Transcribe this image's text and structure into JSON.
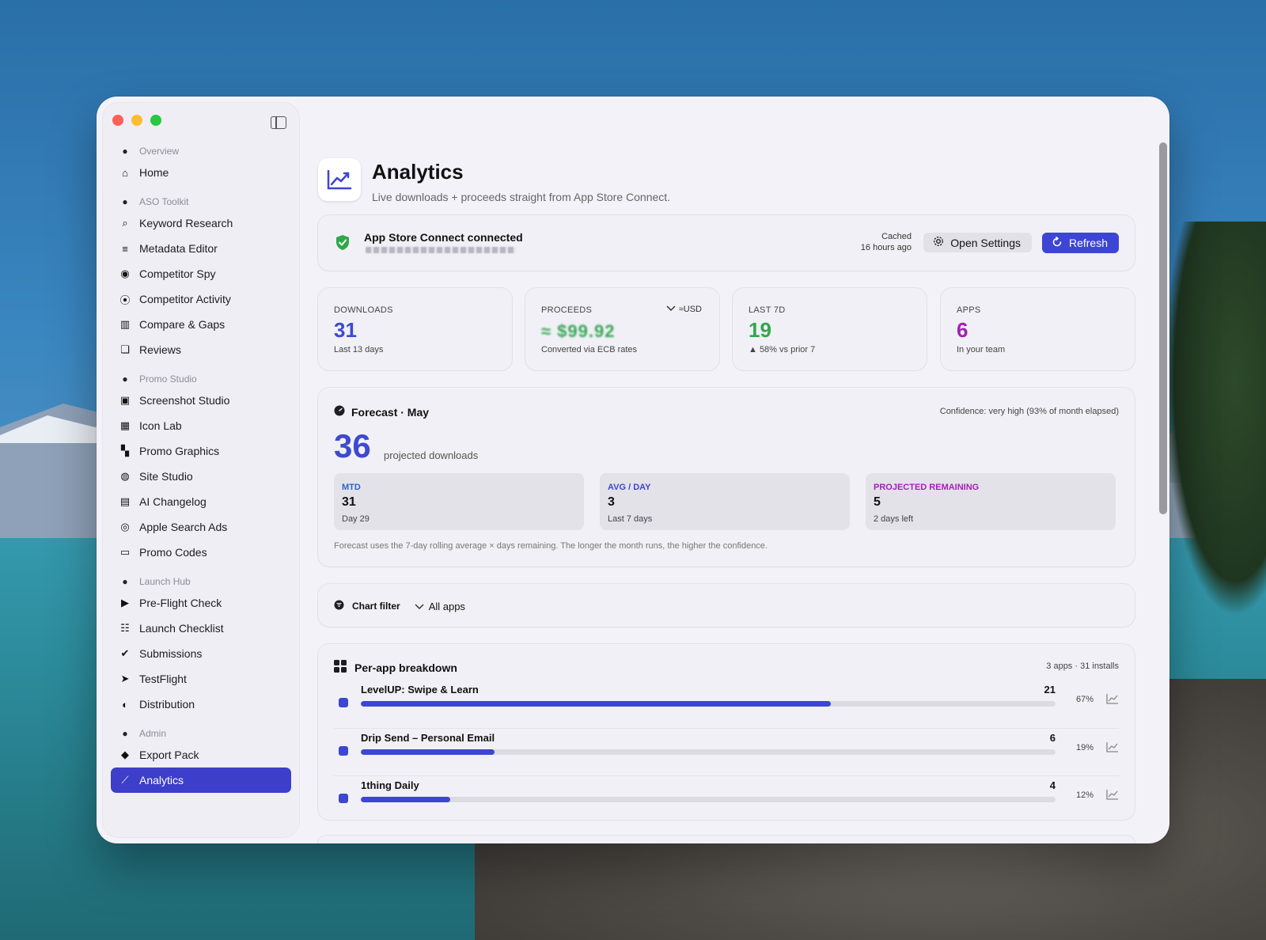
{
  "sidebar": {
    "sections": [
      {
        "label": "Overview",
        "icon": "house-icon",
        "items": [
          {
            "label": "Home",
            "icon": "house-icon",
            "glyph": "⌂"
          }
        ]
      },
      {
        "label": "ASO Toolkit",
        "icon": "magnifier-circle-icon",
        "items": [
          {
            "label": "Keyword Research",
            "icon": "search-icon",
            "glyph": "⌕"
          },
          {
            "label": "Metadata Editor",
            "icon": "text-align-icon",
            "glyph": "≡"
          },
          {
            "label": "Competitor Spy",
            "icon": "eye-icon",
            "glyph": "◉"
          },
          {
            "label": "Competitor Activity",
            "icon": "broadcast-icon",
            "glyph": "⦿"
          },
          {
            "label": "Compare & Gaps",
            "icon": "columns-icon",
            "glyph": "▥"
          },
          {
            "label": "Reviews",
            "icon": "chat-bubbles-icon",
            "glyph": "❏"
          }
        ]
      },
      {
        "label": "Promo Studio",
        "icon": "bag-icon",
        "items": [
          {
            "label": "Screenshot Studio",
            "icon": "photos-icon",
            "glyph": "▣"
          },
          {
            "label": "Icon Lab",
            "icon": "app-grid-icon",
            "glyph": "▦"
          },
          {
            "label": "Promo Graphics",
            "icon": "layout-icon",
            "glyph": "▚"
          },
          {
            "label": "Site Studio",
            "icon": "globe-icon",
            "glyph": "◍"
          },
          {
            "label": "AI Changelog",
            "icon": "document-icon",
            "glyph": "▤"
          },
          {
            "label": "Apple Search Ads",
            "icon": "search-badge-icon",
            "glyph": "◎"
          },
          {
            "label": "Promo Codes",
            "icon": "ticket-icon",
            "glyph": "▭"
          }
        ]
      },
      {
        "label": "Launch Hub",
        "icon": "checkmark-circle-icon",
        "items": [
          {
            "label": "Pre-Flight Check",
            "icon": "play-circle-icon",
            "glyph": "▶"
          },
          {
            "label": "Launch Checklist",
            "icon": "checklist-icon",
            "glyph": "☷"
          },
          {
            "label": "Submissions",
            "icon": "seal-check-icon",
            "glyph": "✔"
          },
          {
            "label": "TestFlight",
            "icon": "paperplane-icon",
            "glyph": "➤"
          },
          {
            "label": "Distribution",
            "icon": "globe-grid-icon",
            "glyph": "◐"
          }
        ]
      },
      {
        "label": "Admin",
        "icon": "tools-icon",
        "items": [
          {
            "label": "Export Pack",
            "icon": "box-icon",
            "glyph": "◆"
          },
          {
            "label": "Analytics",
            "icon": "chart-line-icon",
            "glyph": "⟋",
            "active": true
          }
        ]
      }
    ]
  },
  "header": {
    "title": "Analytics",
    "subtitle": "Live downloads + proceeds straight from App Store Connect."
  },
  "connection": {
    "title": "App Store Connect connected",
    "cached_label": "Cached",
    "cached_time": "16 hours ago",
    "settings_label": "Open Settings",
    "refresh_label": "Refresh"
  },
  "stats": {
    "downloads": {
      "label": "DOWNLOADS",
      "value": "31",
      "sub": "Last 13 days",
      "color": "#3d4ad0"
    },
    "proceeds": {
      "label": "PROCEEDS",
      "currency": "≈USD",
      "value": "≈ $99.92",
      "sub": "Converted via ECB rates",
      "color": "#34a853"
    },
    "last7d": {
      "label": "LAST 7D",
      "value": "19",
      "sub": "▲ 58% vs prior 7",
      "color": "#2fa84a"
    },
    "apps": {
      "label": "APPS",
      "value": "6",
      "sub": "In your team",
      "color": "#a21fb8"
    }
  },
  "forecast": {
    "title": "Forecast · May",
    "confidence": "Confidence: very high (93% of month elapsed)",
    "projected": "36",
    "projected_label": "projected downloads",
    "cards": [
      {
        "label": "MTD",
        "value": "31",
        "sub": "Day 29",
        "color": "#2f62c7"
      },
      {
        "label": "AVG / DAY",
        "value": "3",
        "sub": "Last 7 days",
        "color": "#3d46c9"
      },
      {
        "label": "PROJECTED REMAINING",
        "value": "5",
        "sub": "2 days left",
        "color": "#a21fb8"
      }
    ],
    "note": "Forecast uses the 7-day rolling average × days remaining. The longer the month runs, the higher the confidence."
  },
  "filter": {
    "label": "Chart filter",
    "value": "All apps"
  },
  "breakdown": {
    "title": "Per-app breakdown",
    "meta": "3 apps · 31 installs",
    "rows": [
      {
        "name": "LevelUP: Swipe & Learn",
        "count": "21",
        "pct": "67%",
        "share": 0.677
      },
      {
        "name": "Drip Send – Personal Email",
        "count": "6",
        "pct": "19%",
        "share": 0.193
      },
      {
        "name": "1thing Daily",
        "count": "4",
        "pct": "12%",
        "share": 0.129
      }
    ]
  },
  "colors": {
    "accent": "#3d46d3",
    "sidebar_active": "#3d3ec9"
  }
}
